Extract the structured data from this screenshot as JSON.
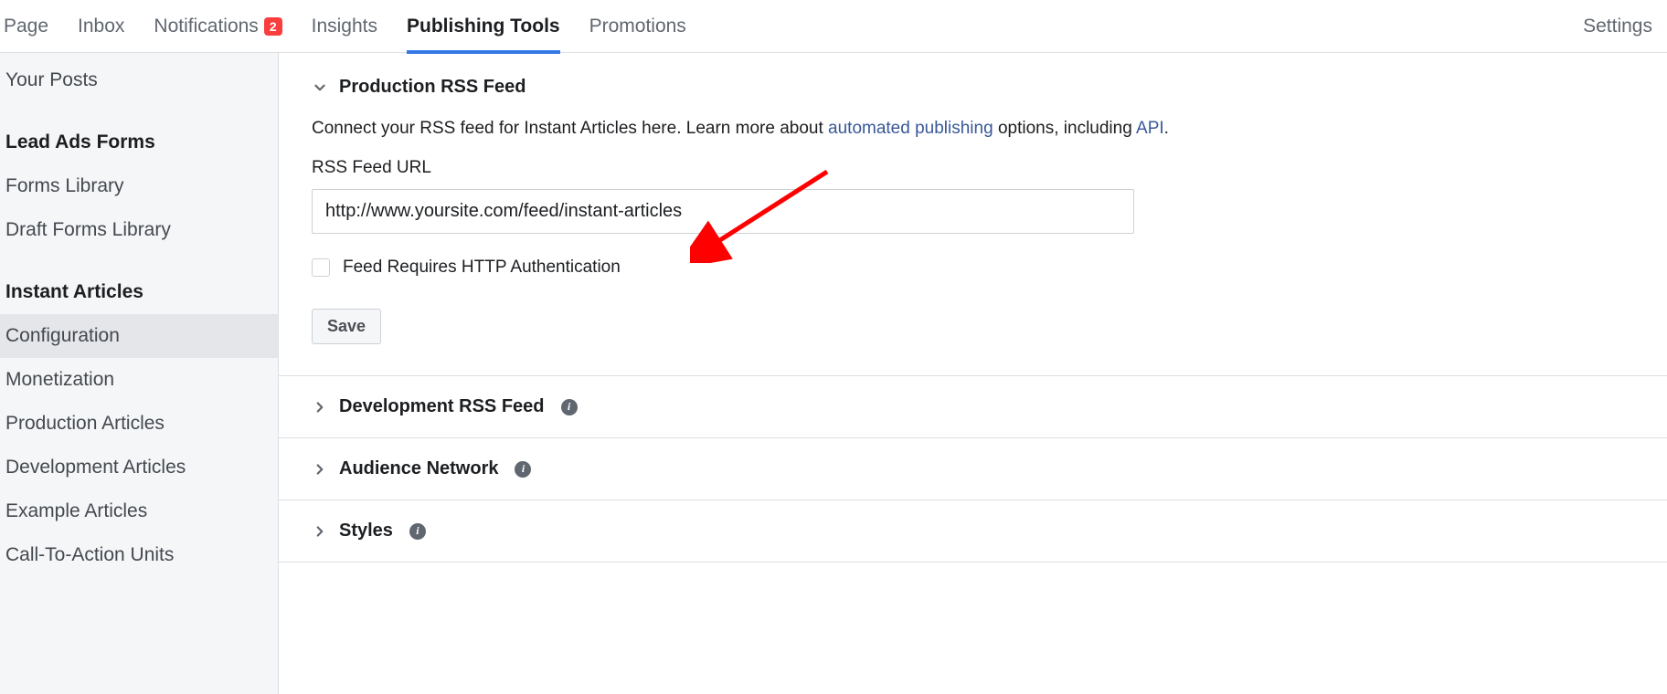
{
  "topnav": {
    "tabs": [
      {
        "label": "Page"
      },
      {
        "label": "Inbox"
      },
      {
        "label": "Notifications",
        "badge": "2"
      },
      {
        "label": "Insights"
      },
      {
        "label": "Publishing Tools",
        "active": true
      },
      {
        "label": "Promotions"
      }
    ],
    "settings_label": "Settings"
  },
  "sidebar": {
    "groups": [
      {
        "items": [
          {
            "label": "Your Posts"
          }
        ]
      },
      {
        "heading": "Lead Ads Forms",
        "items": [
          {
            "label": "Forms Library"
          },
          {
            "label": "Draft Forms Library"
          }
        ]
      },
      {
        "heading": "Instant Articles",
        "items": [
          {
            "label": "Configuration",
            "selected": true
          },
          {
            "label": "Monetization"
          },
          {
            "label": "Production Articles"
          },
          {
            "label": "Development Articles"
          },
          {
            "label": "Example Articles"
          },
          {
            "label": "Call-To-Action Units"
          }
        ]
      }
    ]
  },
  "main": {
    "open_section": {
      "title": "Production RSS Feed",
      "desc_before": "Connect your RSS feed for Instant Articles here. Learn more about ",
      "link1": "automated publishing",
      "desc_mid": " options, including ",
      "link2": "API",
      "desc_after": ".",
      "field_label": "RSS Feed URL",
      "rss_url_value": "http://www.yoursite.com/feed/instant-articles",
      "checkbox_label": "Feed Requires HTTP Authentication",
      "save_label": "Save"
    },
    "collapsed_sections": [
      {
        "title": "Development RSS Feed",
        "info": true
      },
      {
        "title": "Audience Network",
        "info": true
      },
      {
        "title": "Styles",
        "info": true
      }
    ]
  },
  "colors": {
    "accent": "#3578e5",
    "link": "#385898",
    "badge": "#fa3e3e",
    "annotation_arrow": "#ff0000"
  }
}
